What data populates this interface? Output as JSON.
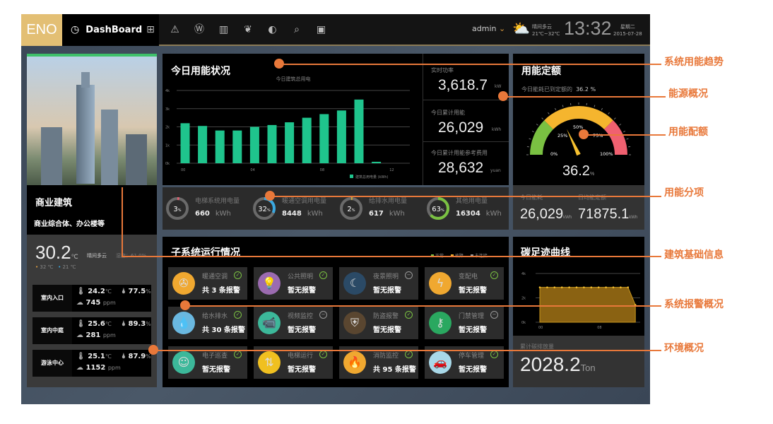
{
  "topbar": {
    "logo": "ENO",
    "dashboard": "DashBoard",
    "nav_icons": [
      "monitor-icon",
      "alert-icon",
      "water-meter-icon",
      "barcode-icon",
      "leaf-icon",
      "pie-icon",
      "report-search-icon",
      "window-icon"
    ],
    "user": "admin",
    "weather": "晴间多云",
    "temp_range": "21℃~32℃",
    "time": "13:32",
    "weekday": "星期二",
    "date": "2015-07-28"
  },
  "building": {
    "type": "商业建筑",
    "desc": "商业综合体、办公楼等",
    "temp": "30.2",
    "temp_unit": "℃",
    "weather": "晴间多云",
    "humidity": "湿度：61.0%",
    "high": "32 ℃",
    "low": "21 ℃",
    "zones": [
      {
        "name": "室内入口",
        "temp": "24.2",
        "hum": "77.5",
        "co2": "745"
      },
      {
        "name": "室内中庭",
        "temp": "25.6",
        "hum": "89.3",
        "co2": "281"
      },
      {
        "name": "游泳中心",
        "temp": "25.1",
        "hum": "87.9",
        "co2": "1152"
      }
    ],
    "temp_unit_s": "℃",
    "hum_unit": "%",
    "co2_unit": "ppm"
  },
  "energy": {
    "title": "今日用能状况",
    "realtime_label": "实时功率",
    "realtime": "3,618.7",
    "realtime_unit": "kW",
    "today_label": "今日累计用能",
    "today": "26,029",
    "today_unit": "kWh",
    "cost_label": "今日累计用能参考费用",
    "cost": "28,632",
    "cost_unit": "yuan"
  },
  "chart_data": [
    {
      "type": "bar",
      "title": "今日建筑总用电",
      "categories": [
        "00",
        "01",
        "02",
        "03",
        "04",
        "05",
        "06",
        "07",
        "08",
        "09",
        "10",
        "11"
      ],
      "x_tick_labels": [
        "00",
        "04",
        "08",
        "12"
      ],
      "y_tick_labels": [
        "0k",
        "1k",
        "2k",
        "3k",
        "4k"
      ],
      "ylim": [
        0,
        4000
      ],
      "series": [
        {
          "name": "建筑总用电量 (kWh)",
          "values": [
            2200,
            2050,
            1800,
            1800,
            2000,
            2100,
            2250,
            2500,
            2700,
            2900,
            3500,
            80
          ]
        }
      ],
      "color": "#1fc48d",
      "grid": true,
      "legend": "bottom"
    },
    {
      "type": "area",
      "title": "碳足迹曲线",
      "x": [
        "00",
        "01",
        "02",
        "03",
        "04",
        "05",
        "06",
        "07",
        "08",
        "09",
        "10",
        "11",
        "12",
        "13"
      ],
      "x_tick_labels": [
        "00",
        "08"
      ],
      "y_tick_labels": [
        "0k",
        "2k",
        "4k"
      ],
      "ylim": [
        0,
        4000
      ],
      "values": [
        2860,
        2860,
        2860,
        2860,
        2860,
        2860,
        2860,
        2860,
        2860,
        2860,
        2860,
        2860,
        2860,
        1420
      ],
      "color": "#c8961e",
      "grid": true
    }
  ],
  "subitems": [
    {
      "name": "电梯系统用电量",
      "pct": 3,
      "value": "660",
      "unit": "kWh",
      "color": "#e06070"
    },
    {
      "name": "暖通空调用电量",
      "pct": 32,
      "value": "8448",
      "unit": "kWh",
      "color": "#3aa8e0"
    },
    {
      "name": "给排水用电量",
      "pct": 2,
      "value": "617",
      "unit": "kWh",
      "color": "#c8b040"
    },
    {
      "name": "其他用电量",
      "pct": 63,
      "value": "16304",
      "unit": "kWh",
      "color": "#7ac142"
    }
  ],
  "quota": {
    "title": "用能定额",
    "desc": "今日能耗已到定额的",
    "desc_pct": "36.2 %",
    "value": "36.2",
    "unit": "%",
    "gauge_pct": 36.2,
    "labels": [
      "0%",
      "25%",
      "50%",
      "75%",
      "100%"
    ],
    "today_label": "今日能耗",
    "today": "26,029",
    "today_unit": "kWh",
    "daily_label": "日均能定额",
    "daily": "71875.1",
    "daily_unit": "kWh"
  },
  "subsystems": {
    "title": "子系统运行情况",
    "legend": [
      {
        "label": "正常",
        "color": "#7ac142"
      },
      {
        "label": "故障",
        "color": "#f0b030"
      },
      {
        "label": "未连接",
        "color": "#999999"
      }
    ],
    "items": [
      {
        "name": "暖通空调",
        "status": "共 3 条报警",
        "icon": "fan-icon",
        "bg": "#f0a830",
        "g": "✇",
        "ok": true
      },
      {
        "name": "公共照明",
        "status": "暂无报警",
        "icon": "bulb-icon",
        "bg": "#9b6bb0",
        "g": "💡",
        "ok": true
      },
      {
        "name": "夜景照明",
        "status": "暂无报警",
        "icon": "moon-icon",
        "bg": "#2b4a66",
        "g": "☾",
        "ok": false
      },
      {
        "name": "变配电",
        "status": "暂无报警",
        "icon": "lightning-icon",
        "bg": "#f0a830",
        "g": "ϟ",
        "ok": true
      },
      {
        "name": "给水排水",
        "status": "共 30 条报警",
        "icon": "water-drop-icon",
        "bg": "#6ab8e0",
        "g": "💧",
        "ok": true
      },
      {
        "name": "视频监控",
        "status": "暂无报警",
        "icon": "camera-icon",
        "bg": "#3cb89a",
        "g": "📹",
        "ok": false
      },
      {
        "name": "防盗报警",
        "status": "暂无报警",
        "icon": "shield-icon",
        "bg": "#5a4630",
        "g": "⛨",
        "ok": true
      },
      {
        "name": "门禁管理",
        "status": "暂无报警",
        "icon": "key-icon",
        "bg": "#2aa860",
        "g": "⚷",
        "ok": false
      },
      {
        "name": "电子巡查",
        "status": "暂无报警",
        "icon": "guard-icon",
        "bg": "#3cb89a",
        "g": "☺",
        "ok": true
      },
      {
        "name": "电梯运行",
        "status": "暂无报警",
        "icon": "elevator-arrows-icon",
        "bg": "#f0c020",
        "g": "⇅",
        "ok": true
      },
      {
        "name": "消防监控",
        "status": "共 95 条报警",
        "icon": "fire-icon",
        "bg": "#f0a830",
        "g": "🔥",
        "ok": true
      },
      {
        "name": "停车管理",
        "status": "暂无报警",
        "icon": "car-icon",
        "bg": "#a8d8e8",
        "g": "🚗",
        "ok": true
      }
    ]
  },
  "carbon": {
    "title": "碳足迹曲线",
    "total_label": "累计碳排放量",
    "total": "2028.2",
    "total_unit": "Ton"
  },
  "annotations": [
    "系统用能趋势",
    "能源概况",
    "用能配额",
    "用能分项",
    "建筑基础信息",
    "系统报警概况",
    "环境概况"
  ]
}
